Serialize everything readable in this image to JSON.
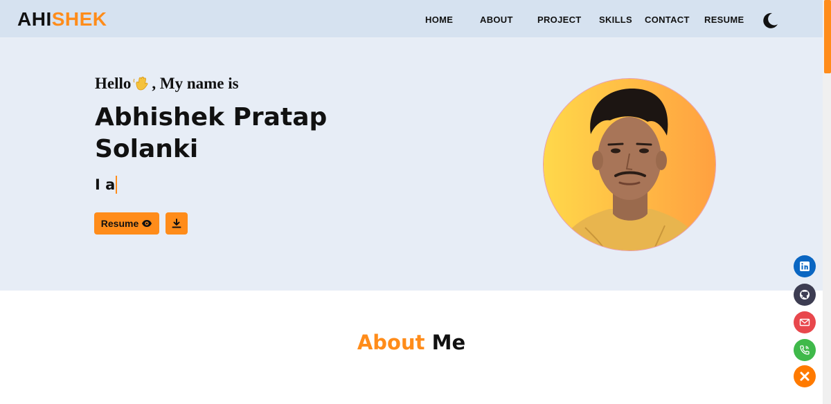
{
  "brand": {
    "part1": "AHI",
    "part2": "SHEK",
    "accent": "#ff8c1a"
  },
  "nav": {
    "items": [
      {
        "label": "HOME"
      },
      {
        "label": "ABOUT"
      },
      {
        "label": "PROJECT"
      },
      {
        "label": "SKILLS"
      },
      {
        "label": "CONTACT"
      },
      {
        "label": "RESUME"
      }
    ],
    "theme_icon": "moon-icon"
  },
  "hero": {
    "greeting_before": "Hello",
    "greeting_emoji": "waving-hand-icon",
    "greeting_after": ", My name is",
    "name": "Abhishek Pratap Solanki",
    "typing_text": "I a",
    "resume_label": "Resume",
    "resume_icon": "eye-icon",
    "download_icon": "download-icon",
    "photo": "profile-photo"
  },
  "about": {
    "title_accent": "About",
    "title_rest": "Me"
  },
  "social": [
    {
      "icon": "linkedin-icon",
      "color": "#0a66c2"
    },
    {
      "icon": "github-icon",
      "color": "#3d3d52"
    },
    {
      "icon": "mail-icon",
      "color": "#e8474c"
    },
    {
      "icon": "phone-icon",
      "color": "#3fb94a"
    },
    {
      "icon": "close-icon",
      "color": "#ff7a00"
    }
  ]
}
